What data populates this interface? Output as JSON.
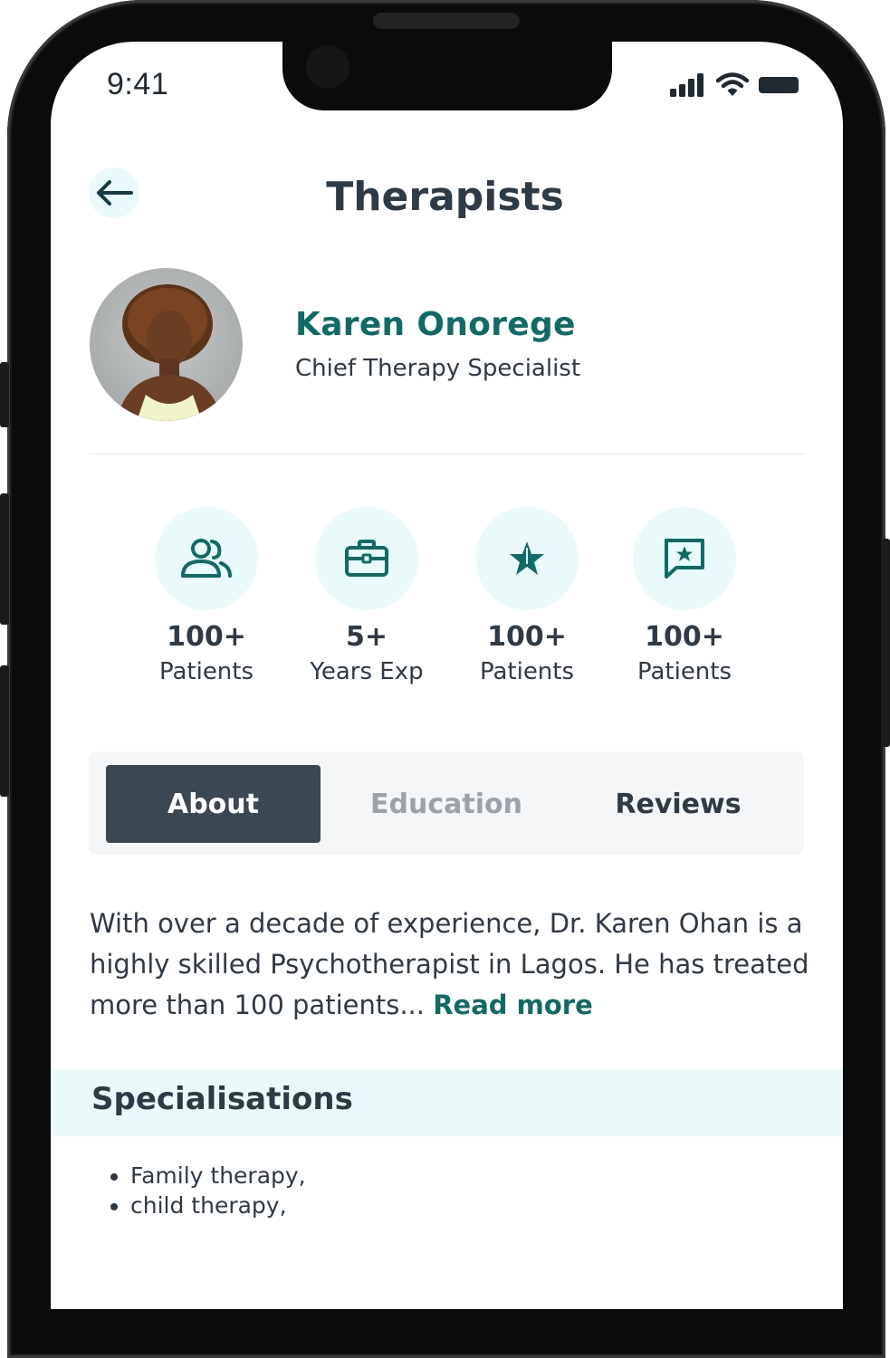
{
  "status_bar": {
    "time": "9:41",
    "icons": [
      "signal-icon",
      "wifi-icon",
      "battery-icon"
    ]
  },
  "header": {
    "back_icon": "arrow-left-icon",
    "title": "Therapists"
  },
  "profile": {
    "name": "Karen Onorege",
    "role": "Chief Therapy Specialist",
    "avatar": "avatar-photo"
  },
  "stats": [
    {
      "icon": "users-icon",
      "value": "100+",
      "label": "Patients"
    },
    {
      "icon": "briefcase-icon",
      "value": "5+",
      "label": "Years Exp"
    },
    {
      "icon": "star-icon",
      "value": "100+",
      "label": "Patients"
    },
    {
      "icon": "review-chat-icon",
      "value": "100+",
      "label": "Patients"
    }
  ],
  "tabs": [
    {
      "label": "About",
      "active": true
    },
    {
      "label": "Education",
      "active": false
    },
    {
      "label": "Reviews",
      "active": false
    }
  ],
  "about": {
    "text": "With over a decade of experience, Dr. Karen Ohan is a highly skilled Psychotherapist in Lagos. He has treated more than 100 patients... ",
    "read_more": "Read more"
  },
  "specialisations": {
    "title": "Specialisations",
    "items": [
      "Family therapy,",
      "child therapy,"
    ]
  },
  "colors": {
    "accent": "#0f6b66",
    "text": "#2e3a45",
    "icon_bg": "#eafafa",
    "active_tab": "#3b4752",
    "inactive_tab": "#9aa3aa"
  }
}
